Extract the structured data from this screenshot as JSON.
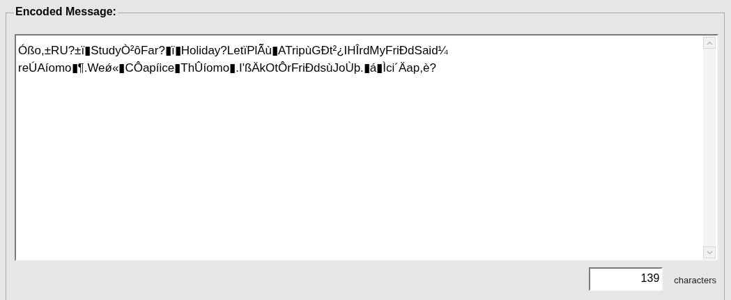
{
  "group": {
    "title": "Encoded Message:"
  },
  "message": {
    "lines": [
      "Óßo,±RU?±ï▮StudyÒ²ôFar?▮ï▮Holiday?LetïPlÃ̃ù▮ATripùGĐt²¿IHÎrdMyFriĐdSaid¼",
      "reÚAíomo▮¶.Weǿ«▮CÔapíice▮ThÛíomo▮.I'ßÄkOtÔrFriĐdsùJoÙþ.▮á▮Ìci´Äap,è?"
    ]
  },
  "count": {
    "value": "139",
    "label": "characters"
  }
}
